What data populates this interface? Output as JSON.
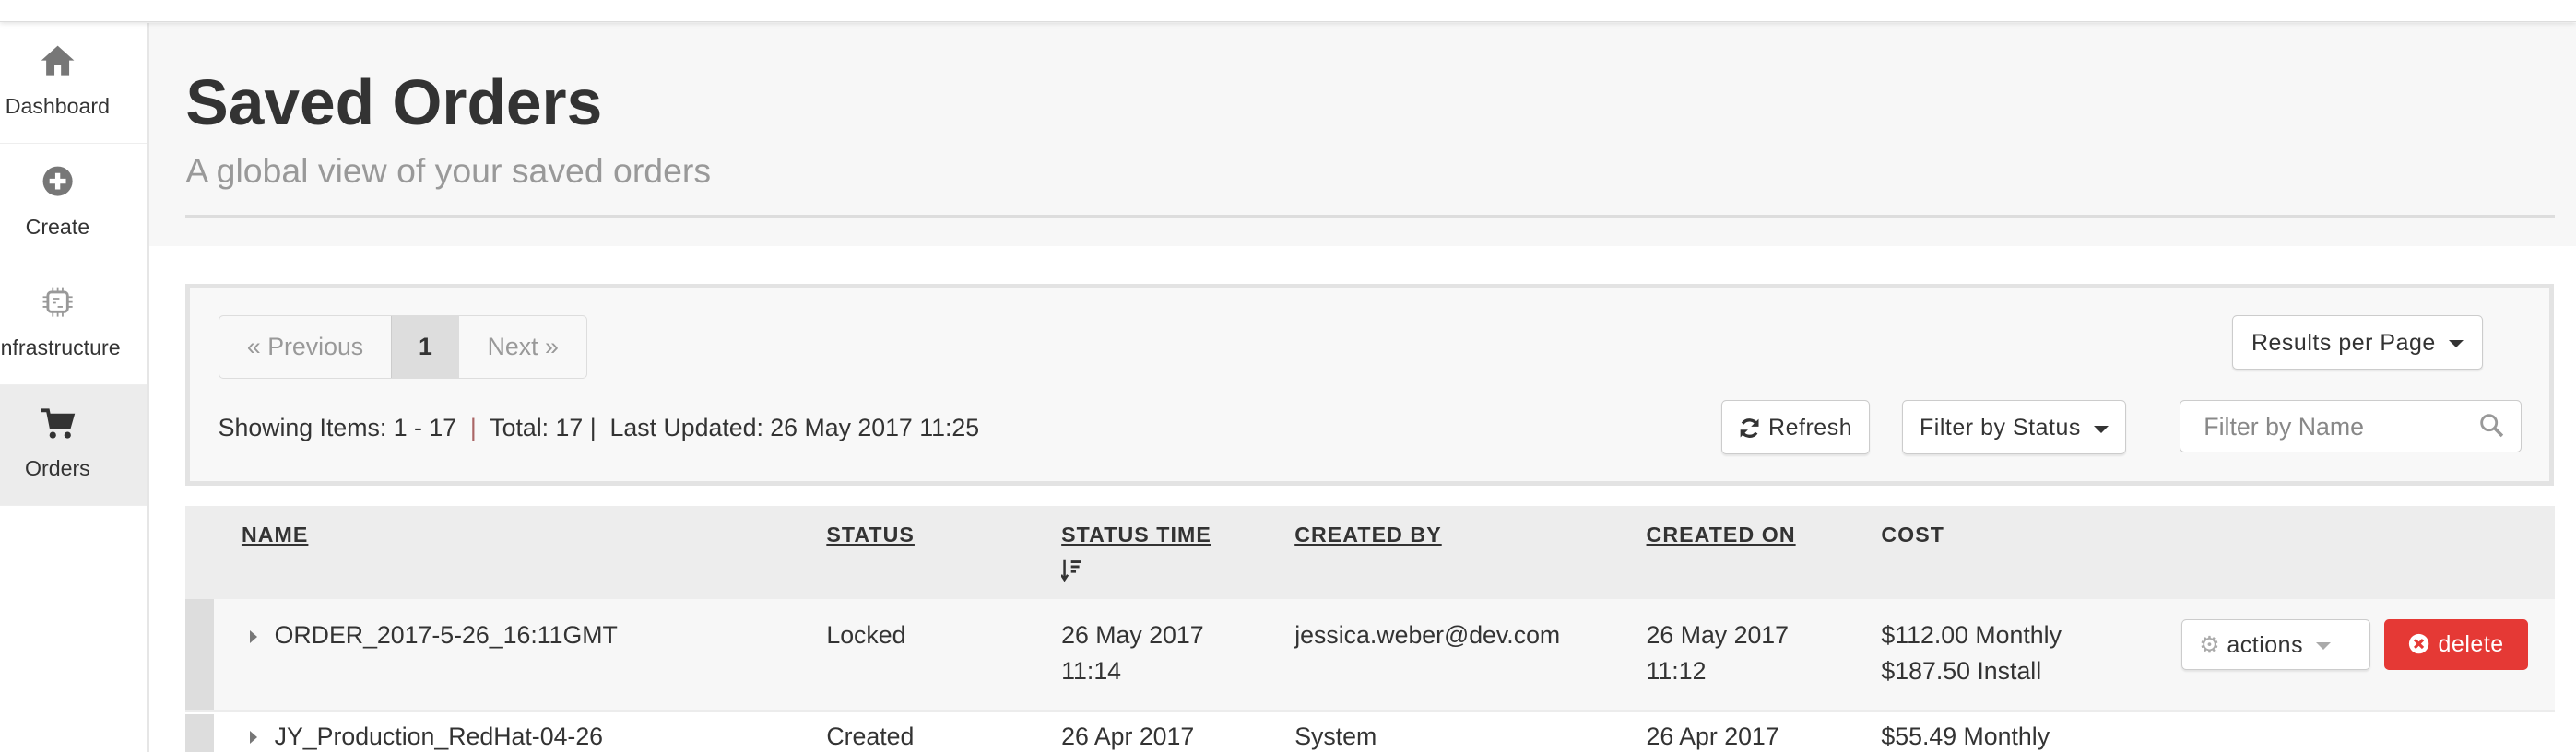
{
  "sidebar": {
    "items": [
      {
        "label": "Dashboard",
        "icon": "home-icon"
      },
      {
        "label": "Create",
        "icon": "plus-circle-icon"
      },
      {
        "label": "Infrastructure",
        "icon": "chip-icon"
      },
      {
        "label": "Orders",
        "icon": "cart-icon",
        "active": true
      }
    ]
  },
  "header": {
    "title": "Saved Orders",
    "subtitle": "A global view of your saved orders"
  },
  "pagination": {
    "previous": "« Previous",
    "current": "1",
    "next": "Next »"
  },
  "summary": {
    "showing": "Showing Items: 1 - 17",
    "sep1": "|",
    "total": "Total: 17",
    "sep2": "|",
    "last_updated": "Last Updated: 26 May 2017 11:25"
  },
  "toolbar": {
    "results_per_page": "Results per Page",
    "refresh": "Refresh",
    "filter_status": "Filter by Status",
    "filter_name_placeholder": "Filter by Name"
  },
  "table": {
    "columns": [
      "NAME",
      "STATUS",
      "STATUS TIME",
      "CREATED BY",
      "CREATED ON",
      "COST"
    ],
    "rows": [
      {
        "name": "ORDER_2017-5-26_16:11GMT",
        "status": "Locked",
        "status_time_1": "26 May 2017",
        "status_time_2": "11:14",
        "created_by": "jessica.weber@dev.com",
        "created_on_1": "26 May 2017",
        "created_on_2": "11:12",
        "cost_1": "$112.00 Monthly",
        "cost_2": "$187.50 Install",
        "actions": "actions",
        "delete": "delete"
      },
      {
        "name": "JY_Production_RedHat-04-26",
        "status": "Created",
        "status_time_1": "26 Apr 2017",
        "created_by": "System",
        "created_on_1": "26 Apr 2017",
        "cost_1": "$55.49 Monthly"
      }
    ]
  },
  "colors": {
    "danger": "#e53935",
    "active_nav": "#ececec"
  }
}
